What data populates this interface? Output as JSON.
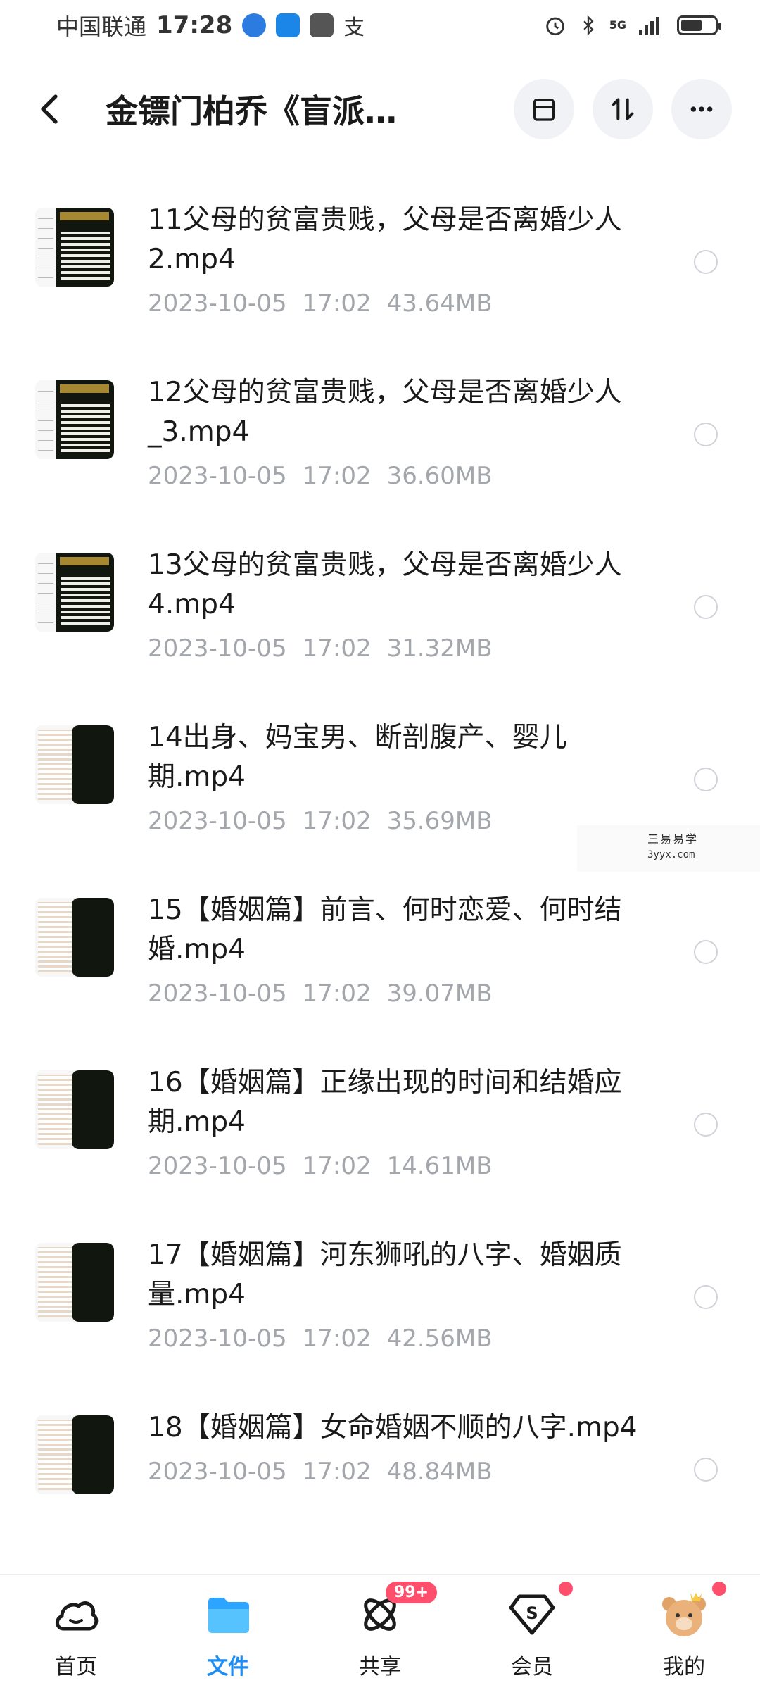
{
  "status_bar": {
    "carrier": "中国联通",
    "time": "17:28",
    "network": "5G"
  },
  "header": {
    "title": "金镖门柏乔《盲派…"
  },
  "files": [
    {
      "name": "11父母的贫富贵贱，父母是否离婚少人2.mp4",
      "date": "2023-10-05",
      "time": "17:02",
      "size": "43.64MB",
      "thumb": "a"
    },
    {
      "name": "12父母的贫富贵贱，父母是否离婚少人_3.mp4",
      "date": "2023-10-05",
      "time": "17:02",
      "size": "36.60MB",
      "thumb": "a"
    },
    {
      "name": "13父母的贫富贵贱，父母是否离婚少人4.mp4",
      "date": "2023-10-05",
      "time": "17:02",
      "size": "31.32MB",
      "thumb": "a"
    },
    {
      "name": "14出身、妈宝男、断剖腹产、婴儿期.mp4",
      "date": "2023-10-05",
      "time": "17:02",
      "size": "35.69MB",
      "thumb": "b"
    },
    {
      "name": "15【婚姻篇】前言、何时恋爱、何时结婚.mp4",
      "date": "2023-10-05",
      "time": "17:02",
      "size": "39.07MB",
      "thumb": "b"
    },
    {
      "name": "16【婚姻篇】正缘出现的时间和结婚应期.mp4",
      "date": "2023-10-05",
      "time": "17:02",
      "size": "14.61MB",
      "thumb": "b"
    },
    {
      "name": "17【婚姻篇】河东狮吼的八字、婚姻质量.mp4",
      "date": "2023-10-05",
      "time": "17:02",
      "size": "42.56MB",
      "thumb": "b"
    },
    {
      "name": "18【婚姻篇】女命婚姻不顺的八字.mp4",
      "date": "2023-10-05",
      "time": "17:02",
      "size": "48.84MB",
      "thumb": "b"
    }
  ],
  "watermark": {
    "line1": "三易易学",
    "line2": "3yyx.com"
  },
  "bottom_nav": {
    "home": "首页",
    "files": "文件",
    "share": "共享",
    "share_badge": "99+",
    "member": "会员",
    "mine": "我的"
  },
  "colors": {
    "accent": "#1e8ef5",
    "badge": "#ff4f6c",
    "meta_text": "#a3a6ab"
  }
}
